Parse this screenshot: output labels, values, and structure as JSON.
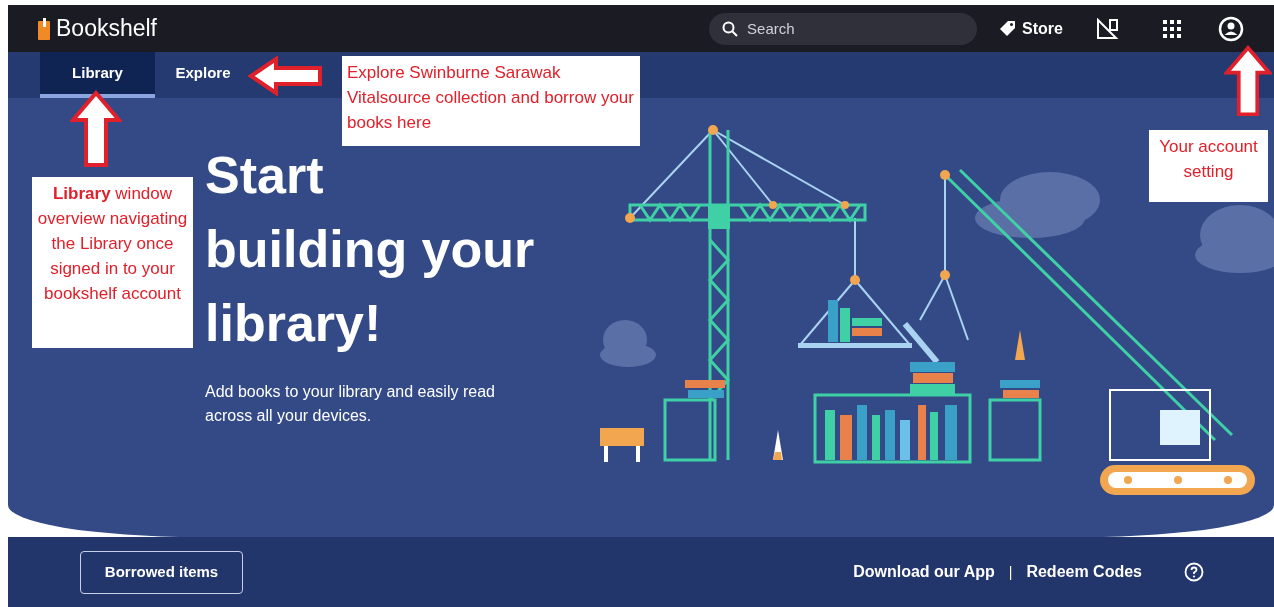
{
  "header": {
    "logo_text": "Bookshelf",
    "search": {
      "placeholder": "Search"
    },
    "store": "Store"
  },
  "tabs": [
    {
      "label": "Library",
      "selected": true
    },
    {
      "label": "Explore",
      "selected": false
    }
  ],
  "hero": {
    "title": "Start\nbuilding your\nlibrary!",
    "subtitle": "Add books to your library and easily read across all your devices."
  },
  "footer": {
    "button": "Borrowed items",
    "links": [
      "Download our App",
      "Redeem Codes"
    ],
    "separator": "|"
  },
  "annotations": [
    {
      "text": "Explore Swinburne Sarawak Vitalsource collection and borrow your books here"
    },
    {
      "text": "**Library** window overview navigating the Library once signed in to your bookshelf account"
    },
    {
      "text": "Your account setting"
    }
  ]
}
